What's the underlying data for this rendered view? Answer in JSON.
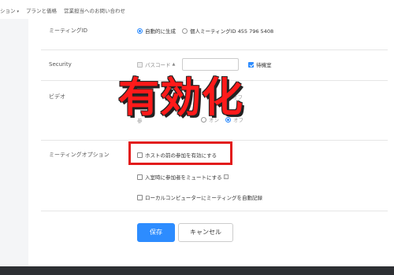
{
  "topnav": {
    "items": [
      "ション",
      "プランと価格",
      "営業担当へのお問い合わせ"
    ]
  },
  "meeting_id": {
    "label": "ミーティングID",
    "auto_option": "自動的に生成",
    "personal_option": "個人ミーティングID 455 796 5408"
  },
  "security": {
    "label": "Security",
    "passcode_label": "パスコード",
    "waiting_room_label": "待機室"
  },
  "video": {
    "label": "ビデオ",
    "host_fragment": "オフ",
    "participant_prefix": "参",
    "participant_off": "オン",
    "participant_on": "オフ"
  },
  "overlay": {
    "text": "有効化"
  },
  "meeting_options": {
    "label": "ミーティングオプション",
    "options": [
      "ホストの前の参加を有効にする",
      "入室時に参加者をミュートにする",
      "ローカルコンピューターにミーティングを自動記録"
    ]
  },
  "actions": {
    "save": "保存",
    "cancel": "キャンセル"
  },
  "colors": {
    "accent": "#2d8cff",
    "highlight": "#e21b1b",
    "overlay_text": "#ff1a1a"
  }
}
